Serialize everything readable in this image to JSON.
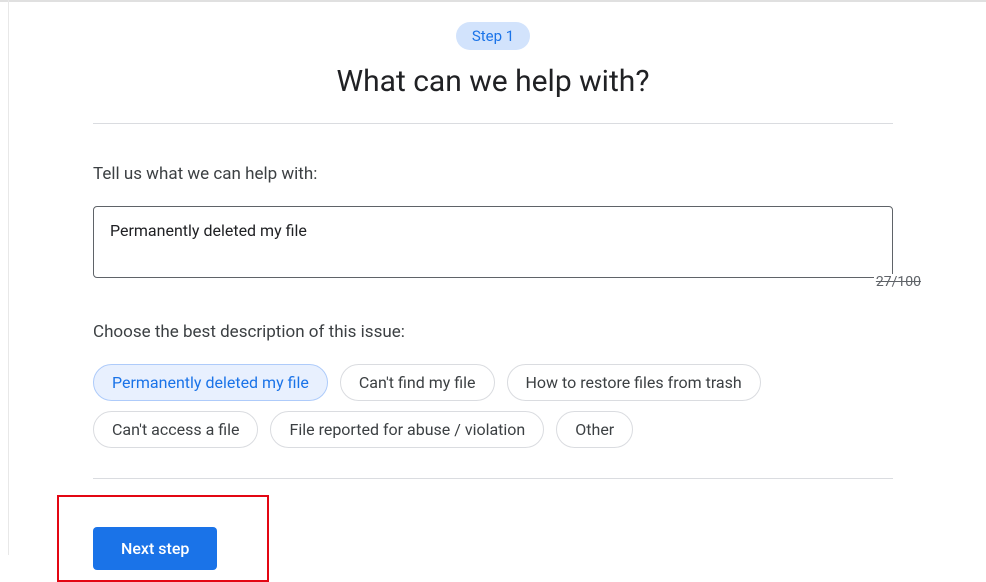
{
  "step": {
    "badge": "Step 1"
  },
  "heading": "What can we help with?",
  "form": {
    "prompt": "Tell us what we can help with:",
    "value": "Permanently deleted my file",
    "counter": "27/100"
  },
  "issue": {
    "prompt": "Choose the best description of this issue:",
    "options": [
      {
        "label": "Permanently deleted my file",
        "selected": true
      },
      {
        "label": "Can't find my file",
        "selected": false
      },
      {
        "label": "How to restore files from trash",
        "selected": false
      },
      {
        "label": "Can't access a file",
        "selected": false
      },
      {
        "label": "File reported for abuse / violation",
        "selected": false
      },
      {
        "label": "Other",
        "selected": false
      }
    ]
  },
  "action": {
    "next": "Next step"
  }
}
